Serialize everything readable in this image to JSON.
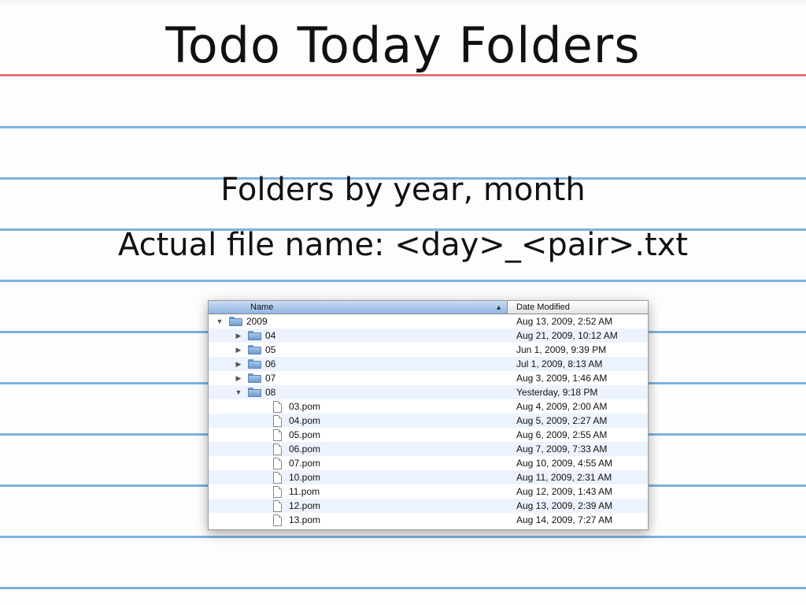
{
  "slide": {
    "title": "Todo Today Folders",
    "line1": "Folders by year, month",
    "line2": "Actual file name: <day>_<pair>.txt"
  },
  "finder": {
    "columns": {
      "name": "Name",
      "date": "Date Modified"
    },
    "rows": [
      {
        "name": "2009",
        "date": "Aug 13, 2009, 2:52 AM",
        "kind": "folder",
        "expanded": true,
        "level": 0
      },
      {
        "name": "04",
        "date": "Aug 21, 2009, 10:12 AM",
        "kind": "folder",
        "expanded": false,
        "level": 1
      },
      {
        "name": "05",
        "date": "Jun 1, 2009, 9:39 PM",
        "kind": "folder",
        "expanded": false,
        "level": 1
      },
      {
        "name": "06",
        "date": "Jul 1, 2009, 8:13 AM",
        "kind": "folder",
        "expanded": false,
        "level": 1
      },
      {
        "name": "07",
        "date": "Aug 3, 2009, 1:46 AM",
        "kind": "folder",
        "expanded": false,
        "level": 1
      },
      {
        "name": "08",
        "date": "Yesterday, 9:18 PM",
        "kind": "folder",
        "expanded": true,
        "level": 1
      },
      {
        "name": "03.pom",
        "date": "Aug 4, 2009, 2:00 AM",
        "kind": "file",
        "level": 2
      },
      {
        "name": "04.pom",
        "date": "Aug 5, 2009, 2:27 AM",
        "kind": "file",
        "level": 2
      },
      {
        "name": "05.pom",
        "date": "Aug 6, 2009, 2:55 AM",
        "kind": "file",
        "level": 2
      },
      {
        "name": "06.pom",
        "date": "Aug 7, 2009, 7:33 AM",
        "kind": "file",
        "level": 2
      },
      {
        "name": "07.pom",
        "date": "Aug 10, 2009, 4:55 AM",
        "kind": "file",
        "level": 2
      },
      {
        "name": "10.pom",
        "date": "Aug 11, 2009, 2:31 AM",
        "kind": "file",
        "level": 2
      },
      {
        "name": "11.pom",
        "date": "Aug 12, 2009, 1:43 AM",
        "kind": "file",
        "level": 2
      },
      {
        "name": "12.pom",
        "date": "Aug 13, 2009, 2:39 AM",
        "kind": "file",
        "level": 2
      },
      {
        "name": "13.pom",
        "date": "Aug 14, 2009, 7:27 AM",
        "kind": "file",
        "level": 2
      }
    ]
  },
  "icons": {
    "expanded": "disclosure-triangle-open-icon",
    "collapsed": "disclosure-triangle-closed-icon",
    "folder": "folder-icon",
    "file": "document-icon",
    "sort": "sort-ascending-icon"
  },
  "colors": {
    "red_rule": "#e8707a",
    "blue_rule": "#7bb2e0",
    "selected_header": "#90b5e2",
    "stripe": "#edf3fe"
  }
}
